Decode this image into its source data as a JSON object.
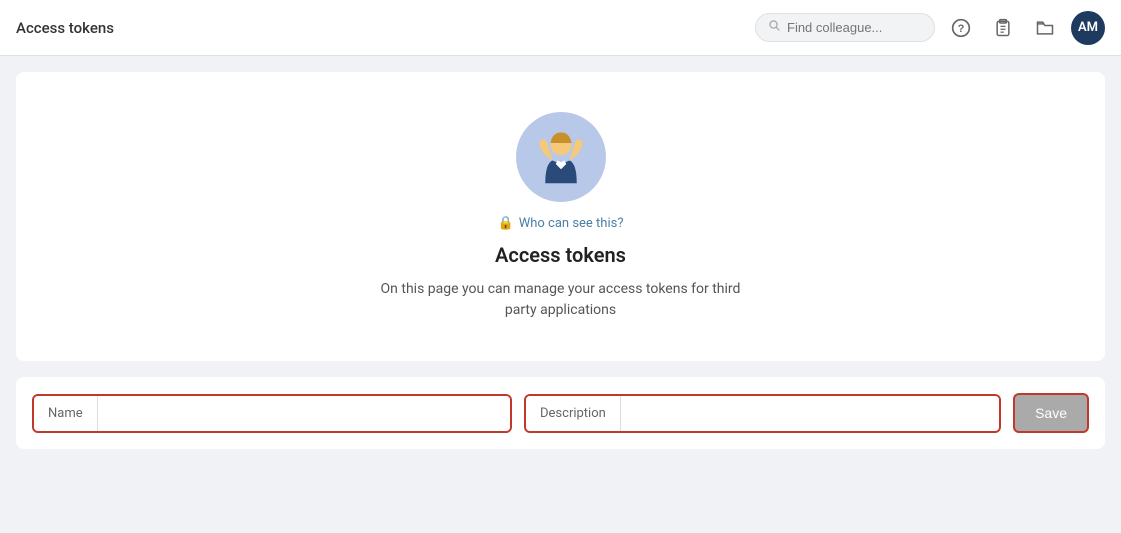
{
  "header": {
    "title": "Access tokens",
    "search_placeholder": "Find colleague...",
    "avatar_initials": "AM"
  },
  "card": {
    "who_can_see_label": "Who can see this?",
    "title": "Access tokens",
    "description": "On this page you can manage your access tokens for third party applications"
  },
  "form": {
    "name_label": "Name",
    "name_placeholder": "",
    "description_label": "Description",
    "description_placeholder": "",
    "save_label": "Save"
  }
}
